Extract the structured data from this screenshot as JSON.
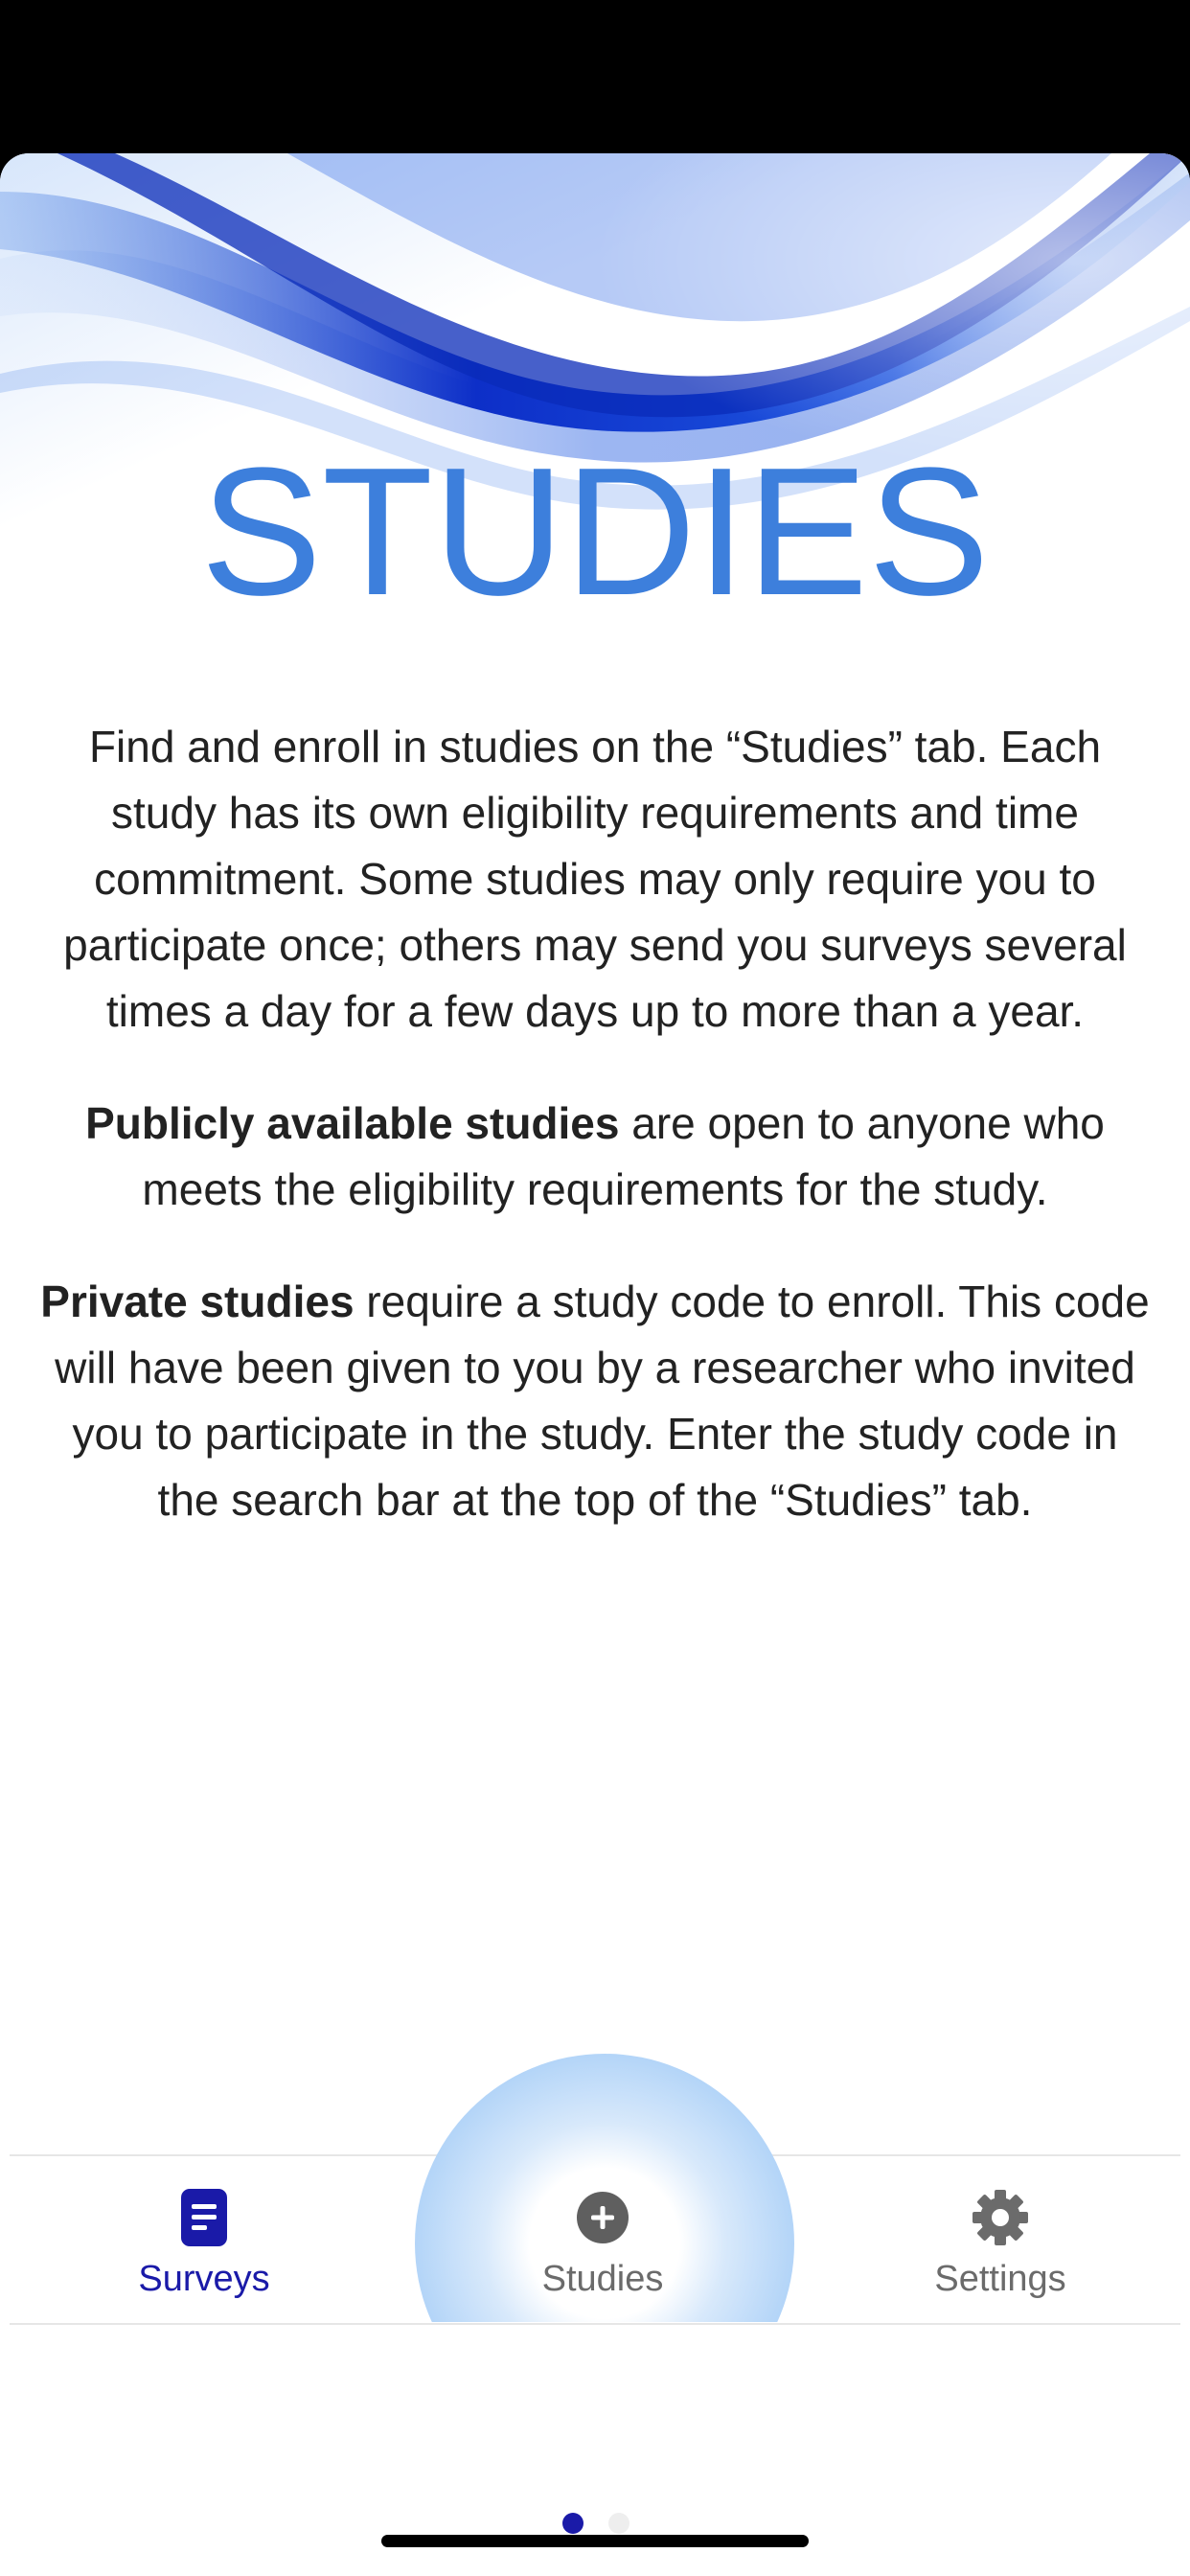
{
  "hero": {
    "heading": "STUDIES",
    "image": "blue-wave-graphic"
  },
  "content": {
    "paragraph1": "Find and enroll in studies on the “Studies” tab. Each study has its own eligibility requirements and time commitment. Some studies may only require you to participate once; others may send you surveys several times a day for a few days up to more than a year.",
    "paragraph2_bold": "Publicly available studies",
    "paragraph2_rest": " are open to anyone who meets the eligibility requirements for the study.",
    "paragraph3_bold": "Private studies",
    "paragraph3_rest": " require a study code to enroll. This code will have been given to you by a researcher who invited you to participate in the study. Enter the study code in the search bar at the top of the “Studies” tab."
  },
  "tabbar": {
    "tabs": [
      {
        "label": "Surveys",
        "icon": "document-icon",
        "active": true
      },
      {
        "label": "Studies",
        "icon": "plus-circle-icon",
        "active": false
      },
      {
        "label": "Settings",
        "icon": "gear-icon",
        "active": false
      }
    ]
  },
  "pager": {
    "pages": 2,
    "current": 1
  },
  "colors": {
    "heading": "#3d7fdc",
    "active_tab": "#1a1aa8",
    "inactive_tab": "#6b6b6b",
    "fab_glow": "#9cc7f5"
  }
}
